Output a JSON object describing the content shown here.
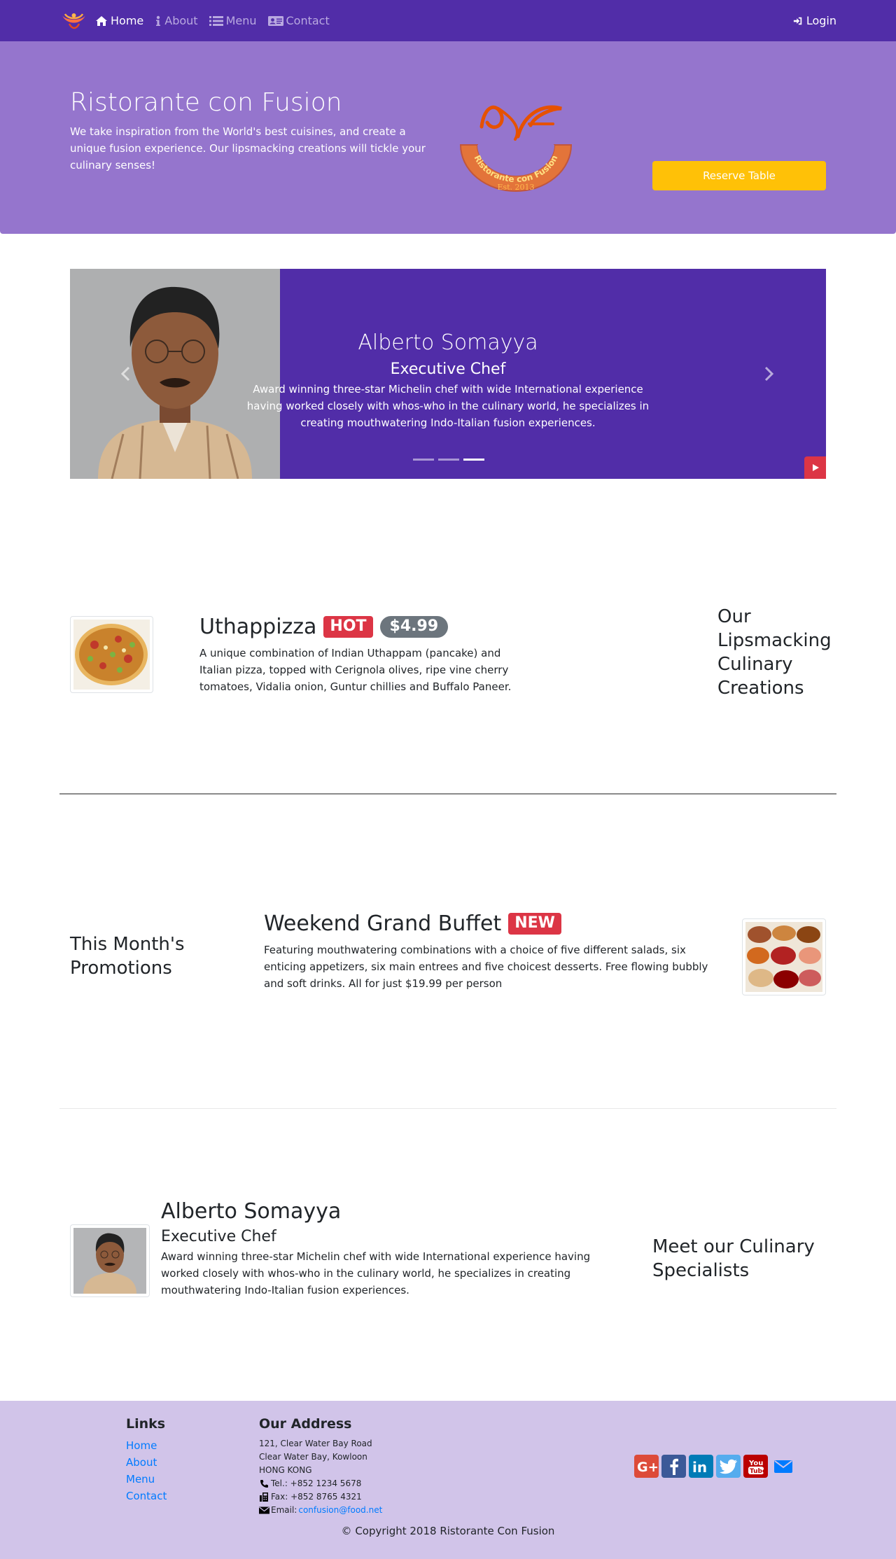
{
  "nav": {
    "items": [
      {
        "label": "Home",
        "icon": "home-icon",
        "active": true
      },
      {
        "label": "About",
        "icon": "info-icon",
        "active": false
      },
      {
        "label": "Menu",
        "icon": "list-icon",
        "active": false
      },
      {
        "label": "Contact",
        "icon": "address-card-icon",
        "active": false
      }
    ],
    "login_label": "Login",
    "colors": {
      "bar": "#512da8",
      "active": "#ffffff",
      "inactive": "#b9a9e0"
    }
  },
  "jumbotron": {
    "title": "Ristorante con Fusion",
    "description": "We take inspiration from the World's best cuisines, and create a unique fusion experience. Our lipsmacking creations will tickle your culinary senses!",
    "logo_text": "Ristorante con Fusion",
    "logo_est": "Est. 2013",
    "reserve_label": "Reserve Table",
    "colors": {
      "background": "#9575cd",
      "button": "#ffc107"
    }
  },
  "carousel": {
    "title": "Alberto Somayya",
    "subtitle": "Executive Chef",
    "description": "Award winning three-star Michelin chef with wide International experience having worked closely with whos-who in the culinary world, he specializes in creating mouthwatering Indo-Italian fusion experiences.",
    "slide_count": 3,
    "active_slide": 3
  },
  "dish": {
    "name": "Uthappizza",
    "badge": "HOT",
    "price": "$4.99",
    "description": "A unique combination of Indian Uthappam (pancake) and Italian pizza, topped with Cerignola olives, ripe vine cherry tomatoes, Vidalia onion, Guntur chillies and Buffalo Paneer.",
    "section_heading": "Our Lipsmacking Culinary Creations"
  },
  "promotion": {
    "name": "Weekend Grand Buffet",
    "badge": "NEW",
    "description": "Featuring mouthwatering combinations with a choice of five different salads, six enticing appetizers, six main entrees and five choicest desserts. Free flowing bubbly and soft drinks. All for just $19.99 per person",
    "section_heading": "This Month's Promotions"
  },
  "leader": {
    "name": "Alberto Somayya",
    "designation": "Executive Chef",
    "description": "Award winning three-star Michelin chef with wide International experience having worked closely with whos-who in the culinary world, he specializes in creating mouthwatering Indo-Italian fusion experiences.",
    "section_heading": "Meet our Culinary Specialists"
  },
  "footer": {
    "links_heading": "Links",
    "links": [
      "Home",
      "About",
      "Menu",
      "Contact"
    ],
    "address_heading": "Our Address",
    "address_lines": [
      "121, Clear Water Bay Road",
      "Clear Water Bay, Kowloon",
      "HONG KONG"
    ],
    "tel": "Tel.: +852 1234 5678",
    "fax": "Fax: +852 8765 4321",
    "email_label": "Email: ",
    "email": "confusion@food.net",
    "social": [
      {
        "icon": "google-plus-icon",
        "color": "#dd4b39"
      },
      {
        "icon": "facebook-icon",
        "color": "#3b5998"
      },
      {
        "icon": "linkedin-icon",
        "color": "#007bb6"
      },
      {
        "icon": "twitter-icon",
        "color": "#55acee"
      },
      {
        "icon": "youtube-icon",
        "color": "#bb0000"
      },
      {
        "icon": "mail-icon",
        "color": "#007bff"
      }
    ],
    "copyright": "© Copyright 2018 Ristorante Con Fusion",
    "colors": {
      "background": "#d1c4e9",
      "link": "#007bff"
    }
  }
}
